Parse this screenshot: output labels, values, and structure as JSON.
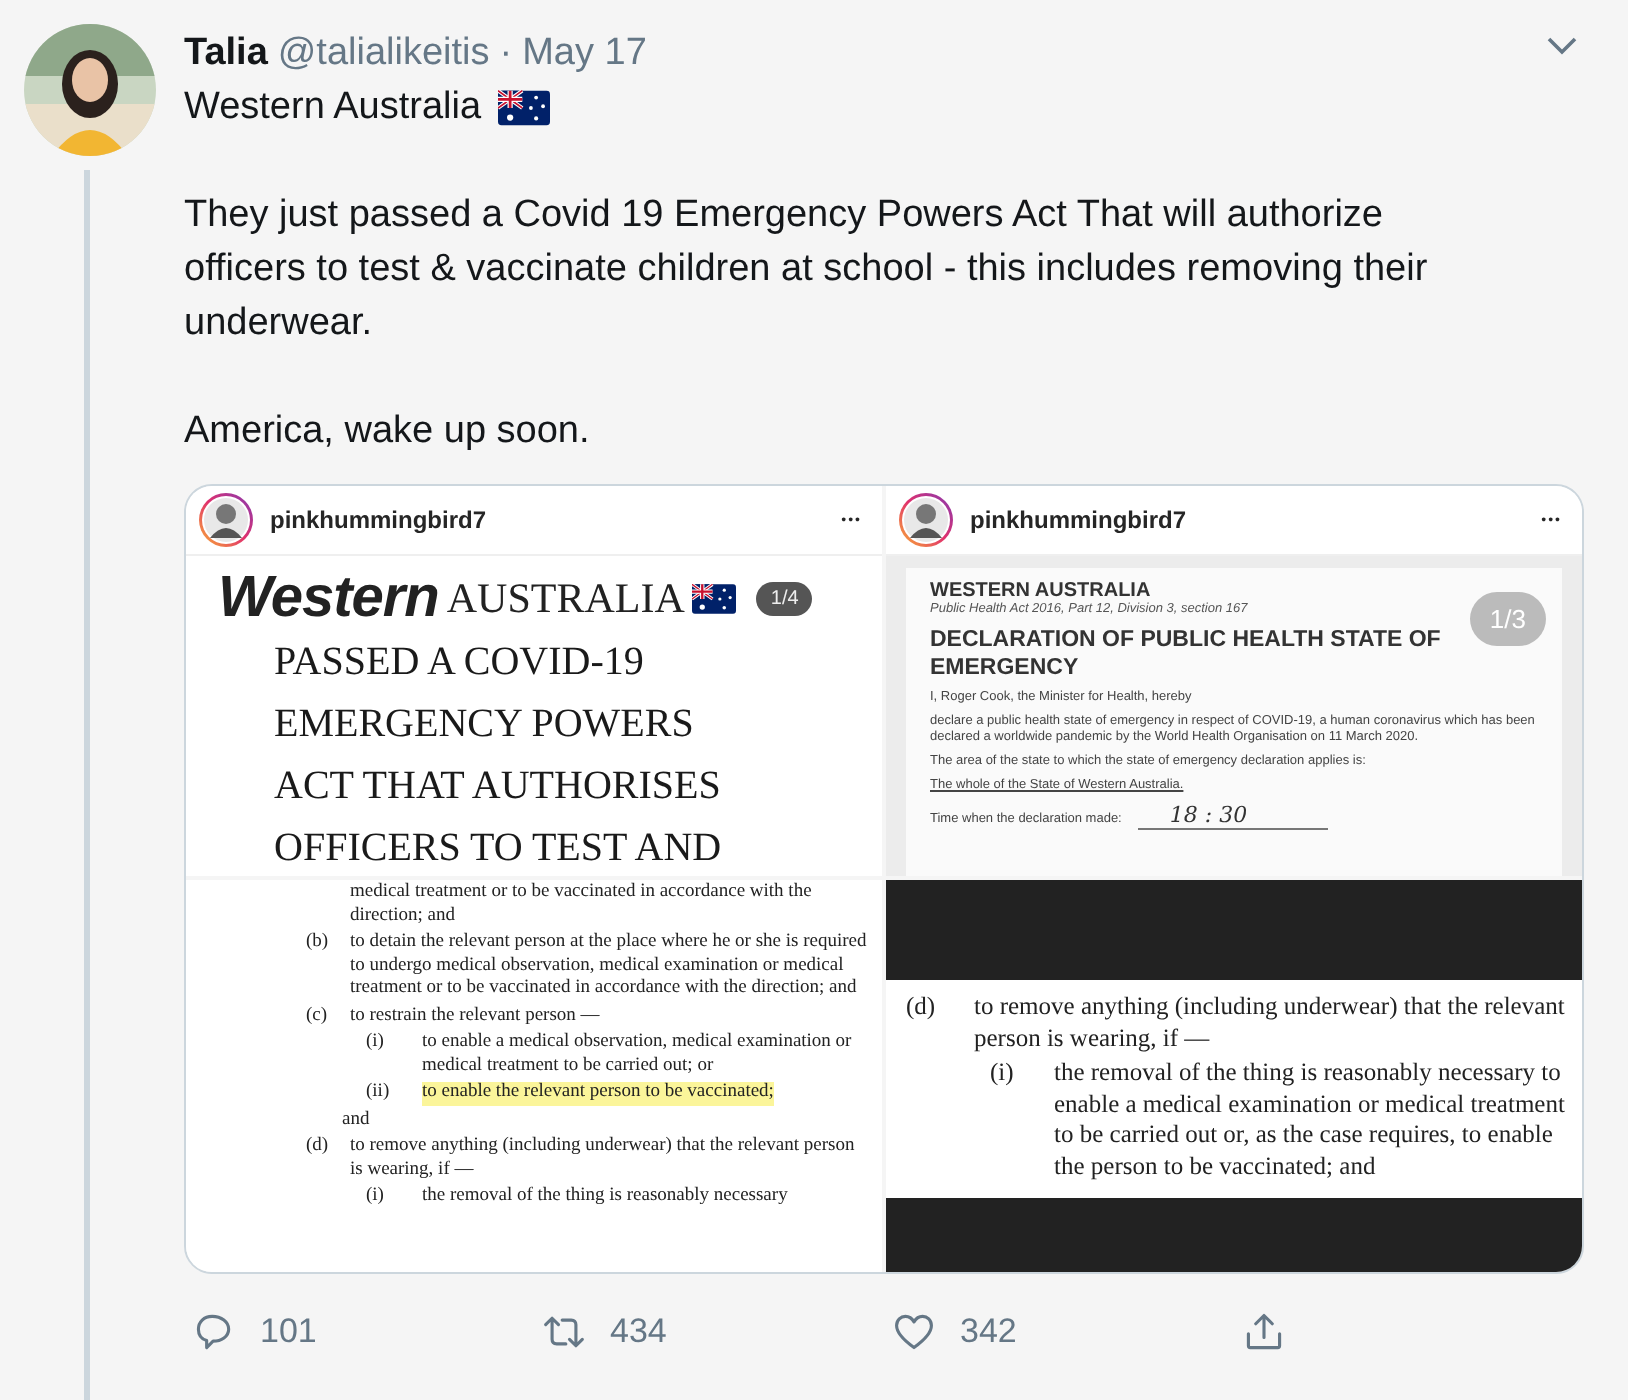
{
  "tweet": {
    "author": {
      "name": "Talia",
      "handle": "@talialikeitis",
      "separator": "·",
      "date": "May 17"
    },
    "text": [
      {
        "kind": "line_with_flag",
        "text": "Western Australia"
      },
      {
        "kind": "paragraph",
        "text": "They just passed a Covid 19 Emergency Powers Act That will authorize officers to test & vaccinate children at school - this includes removing their underwear."
      },
      {
        "kind": "paragraph",
        "text": "America, wake up soon."
      }
    ]
  },
  "media": [
    {
      "kind": "headline_post",
      "user": "pinkhummingbird7",
      "more": "•••",
      "badge": "1/4",
      "title_bold": "Western",
      "title_rest": "AUSTRALIA",
      "lines": [
        "PASSED A COVID-19",
        "EMERGENCY POWERS",
        "ACT THAT AUTHORISES",
        "OFFICERS TO TEST AND"
      ]
    },
    {
      "kind": "document_post",
      "user": "pinkhummingbird7",
      "more": "•••",
      "badge": "1/3",
      "state": "WESTERN AUSTRALIA",
      "act": "Public Health Act 2016, Part 12, Division 3, section 167",
      "heading": "DECLARATION OF PUBLIC HEALTH STATE OF EMERGENCY",
      "paragraphs": [
        {
          "kind": "text",
          "text": "I, Roger Cook, the Minister for Health, hereby"
        },
        {
          "kind": "text",
          "text": "declare a public health state of emergency in respect of COVID-19, a human coronavirus which has been declared a worldwide pandemic by the World Health Organisation on 11 March 2020."
        },
        {
          "kind": "text",
          "text": "The area of the state to which the state of emergency declaration applies is:"
        },
        {
          "kind": "underlined",
          "text": "The whole of the State of Western Australia."
        },
        {
          "kind": "field",
          "text": "Time when the declaration made:",
          "value": "18 : 30"
        }
      ]
    },
    {
      "kind": "legal_excerpt",
      "lead": "medical treatment or to be vaccinated in accordance with the direction; and",
      "items": [
        {
          "label": "(b)",
          "text": "to detain the relevant person at the place where he or she is required to undergo medical observation, medical examination or medical treatment or to be vaccinated in accordance with the direction; and",
          "highlighted": false
        },
        {
          "label": "(c)",
          "text": "to restrain the relevant person —",
          "highlighted": false,
          "children": [
            {
              "label": "(i)",
              "text": "to enable a medical observation, medical examination or medical treatment to be carried out; or",
              "highlighted": false
            },
            {
              "label": "(ii)",
              "text": "to enable the relevant person to be vaccinated;",
              "highlighted": true
            }
          ],
          "after": "and"
        },
        {
          "label": "(d)",
          "text": "to remove anything (including underwear) that the relevant person is wearing, if —",
          "highlighted": false,
          "children": [
            {
              "label": "(i)",
              "text": "the removal of the thing is reasonably necessary",
              "highlighted": false
            }
          ]
        }
      ]
    },
    {
      "kind": "legal_excerpt_dark",
      "items": [
        {
          "label": "(d)",
          "text": "to remove anything (including underwear) that the relevant person is wearing, if —",
          "highlighted": false,
          "children": [
            {
              "label": "(i)",
              "text": "the removal of the thing is reasonably necessary to enable a medical examination or medical treatment to be carried out or, as the case requires, to enable the person to be vaccinated; and",
              "highlighted": false
            }
          ]
        }
      ]
    }
  ],
  "actions": [
    {
      "kind": "reply",
      "count": "101"
    },
    {
      "kind": "retweet",
      "count": "434"
    },
    {
      "kind": "like",
      "count": "342"
    },
    {
      "kind": "share"
    }
  ]
}
